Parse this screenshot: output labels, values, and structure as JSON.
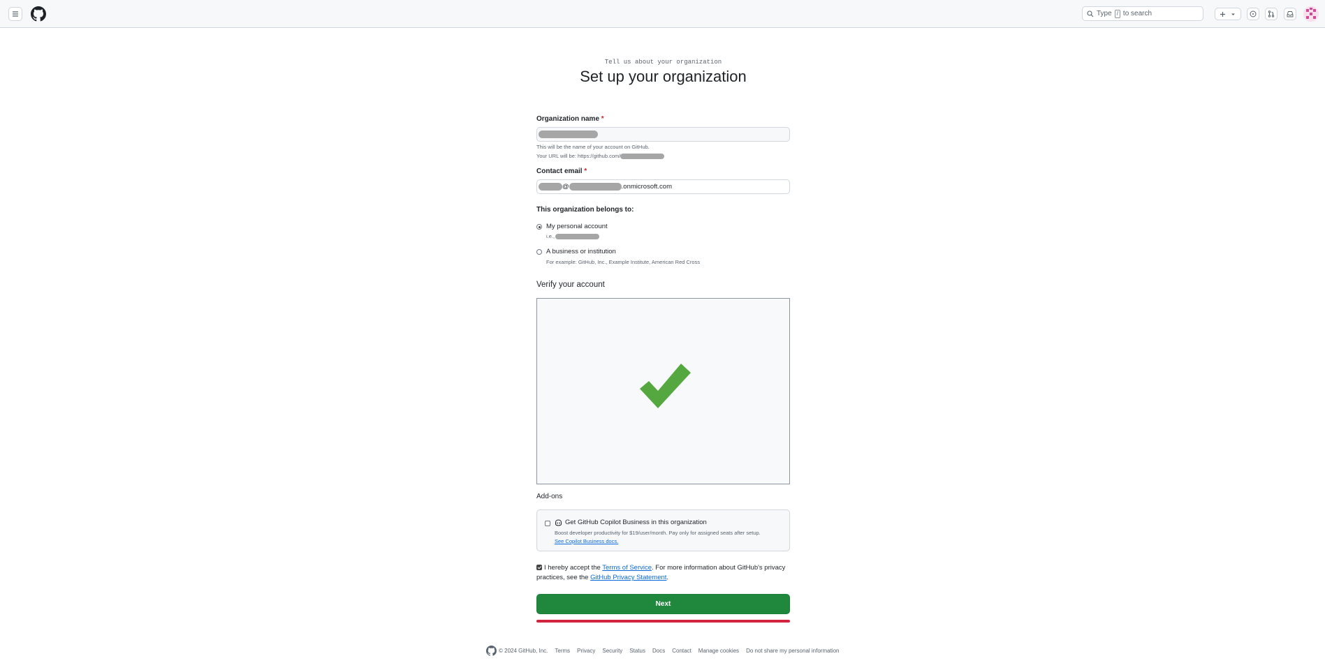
{
  "header": {
    "search_prefix": "Type",
    "search_key": "/",
    "search_suffix": "to search"
  },
  "page": {
    "eyebrow": "Tell us about your organization",
    "title": "Set up your organization"
  },
  "form": {
    "org_name_label": "Organization name",
    "required_mark": "*",
    "org_hint_1": "This will be the name of your account on GitHub.",
    "org_hint_2": "Your URL will be: https://github.com/",
    "email_label": "Contact email",
    "email_at": "@",
    "email_domain": ".onmicrosoft.com",
    "belongs_label": "This organization belongs to:",
    "option_personal": "My personal account",
    "option_personal_hint": "i.e.,",
    "option_business": "A business or institution",
    "option_business_hint": "For example: GitHub, Inc., Example Institute, American Red Cross",
    "selected_option": "personal"
  },
  "verify": {
    "heading": "Verify your account",
    "status": "verified",
    "check_color": "#55a840"
  },
  "addons": {
    "heading": "Add-ons",
    "copilot_title": "Get GitHub Copilot Business in this organization",
    "copilot_desc": "Boost developer productivity for $19/user/month. Pay only for assigned seats after setup.",
    "copilot_link": "See Copilot Business docs.",
    "copilot_checked": false
  },
  "terms": {
    "checked": true,
    "prefix": "I hereby accept the",
    "tos_link": "Terms of Service",
    "middle": ". For more information about GitHub's privacy practices, see the",
    "privacy_link": "GitHub Privacy Statement",
    "suffix": "."
  },
  "next_label": "Next",
  "colors": {
    "primary_button": "#1f883d",
    "highlight_line": "#d1243f",
    "link": "#0969da"
  },
  "footer": {
    "copyright": "© 2024 GitHub, Inc.",
    "links": [
      "Terms",
      "Privacy",
      "Security",
      "Status",
      "Docs",
      "Contact",
      "Manage cookies",
      "Do not share my personal information"
    ]
  }
}
